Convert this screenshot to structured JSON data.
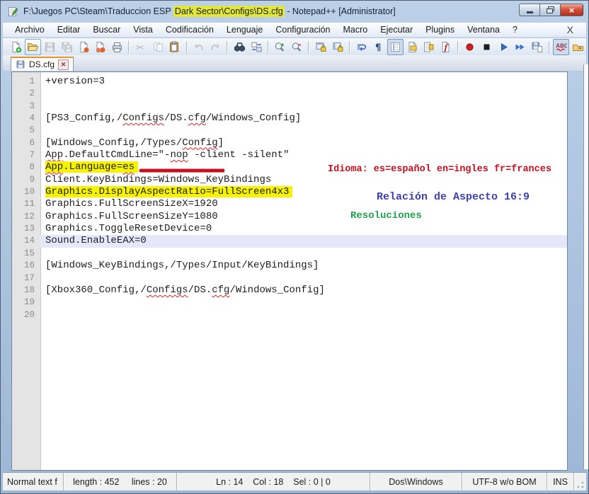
{
  "window": {
    "title_prefix": "F:\\Juegos PC\\Steam\\Traduccion ESP ",
    "title_highlight": "Dark Sector\\Configs\\DS.cfg",
    "title_suffix": " - Notepad++ [Administrator]"
  },
  "menu": {
    "items": [
      "Archivo",
      "Editar",
      "Buscar",
      "Vista",
      "Codificación",
      "Lenguaje",
      "Configuración",
      "Macro",
      "Ejecutar",
      "Plugins",
      "Ventana",
      "?"
    ],
    "close_label": "X"
  },
  "toolbar": {
    "items": [
      {
        "name": "new-file",
        "state": "normal"
      },
      {
        "name": "open-file",
        "state": "hover"
      },
      {
        "name": "save",
        "state": "disabled"
      },
      {
        "name": "save-all",
        "state": "disabled"
      },
      {
        "name": "close",
        "state": "normal"
      },
      {
        "name": "close-all",
        "state": "normal"
      },
      {
        "name": "print",
        "state": "normal"
      },
      {
        "sep": true
      },
      {
        "name": "cut",
        "state": "disabled"
      },
      {
        "name": "copy",
        "state": "disabled"
      },
      {
        "name": "paste",
        "state": "normal"
      },
      {
        "sep": true
      },
      {
        "name": "undo",
        "state": "disabled"
      },
      {
        "name": "redo",
        "state": "disabled"
      },
      {
        "sep": true
      },
      {
        "name": "find",
        "state": "normal"
      },
      {
        "name": "replace",
        "state": "normal"
      },
      {
        "sep": true
      },
      {
        "name": "zoom-in",
        "state": "normal"
      },
      {
        "name": "zoom-out",
        "state": "normal"
      },
      {
        "sep": true
      },
      {
        "name": "sync-vertical",
        "state": "normal"
      },
      {
        "name": "sync-horizontal",
        "state": "normal"
      },
      {
        "sep": true
      },
      {
        "name": "word-wrap",
        "state": "normal"
      },
      {
        "name": "show-all-characters",
        "state": "normal"
      },
      {
        "name": "indent-guide",
        "state": "pressed"
      },
      {
        "name": "user-defined-dialog",
        "state": "normal"
      },
      {
        "name": "doc-map",
        "state": "normal"
      },
      {
        "name": "function-list",
        "state": "normal"
      },
      {
        "sep": true
      },
      {
        "name": "macro-record",
        "state": "normal"
      },
      {
        "name": "macro-stop",
        "state": "normal"
      },
      {
        "name": "macro-play",
        "state": "normal"
      },
      {
        "name": "macro-run-multiple",
        "state": "normal"
      },
      {
        "name": "macro-save",
        "state": "normal"
      },
      {
        "sep": true
      },
      {
        "name": "spell-check",
        "state": "pressed"
      },
      {
        "name": "open-in-explorer",
        "state": "normal"
      }
    ]
  },
  "tab": {
    "label": "DS.cfg"
  },
  "editor": {
    "highlight_color": "#f6f200",
    "current_line_color": "#e7e7fb",
    "lines": [
      {
        "n": 1,
        "segments": [
          {
            "t": "+version=3"
          }
        ]
      },
      {
        "n": 2,
        "segments": []
      },
      {
        "n": 3,
        "segments": []
      },
      {
        "n": 4,
        "segments": [
          {
            "t": "[PS3_Config,/"
          },
          {
            "t": "Configs",
            "sq": true
          },
          {
            "t": "/DS."
          },
          {
            "t": "cfg",
            "sq": true
          },
          {
            "t": "/Windows_Config]"
          }
        ]
      },
      {
        "n": 5,
        "segments": []
      },
      {
        "n": 6,
        "segments": [
          {
            "t": "[Windows_Config,/Types/"
          },
          {
            "t": "Config",
            "sq": true
          },
          {
            "t": "]"
          }
        ]
      },
      {
        "n": 7,
        "segments": [
          {
            "t": "App",
            "sq": true
          },
          {
            "t": ".DefaultCmdLine=\"-"
          },
          {
            "t": "nop",
            "sq": true
          },
          {
            "t": " -client -silent\""
          }
        ]
      },
      {
        "n": 8,
        "hl": true,
        "segments": [
          {
            "t": "App",
            "sq": true
          },
          {
            "t": ".Language="
          },
          {
            "t": "es",
            "sq": true
          }
        ]
      },
      {
        "n": 9,
        "segments": [
          {
            "t": "Client.KeyBindings=Windows_KeyBindings"
          }
        ]
      },
      {
        "n": 10,
        "hl": true,
        "segments": [
          {
            "t": "Graphics.DisplayAspectRatio=FullScreen4x3"
          }
        ]
      },
      {
        "n": 11,
        "segments": [
          {
            "t": "Graphics.FullScreenSizeX=1920"
          }
        ]
      },
      {
        "n": 12,
        "segments": [
          {
            "t": "Graphics.FullScreenSizeY=1080"
          }
        ]
      },
      {
        "n": 13,
        "segments": [
          {
            "t": "Graphics.ToggleResetDevice=0"
          }
        ]
      },
      {
        "n": 14,
        "current": true,
        "segments": [
          {
            "t": "Sound.EnableEAX=0"
          }
        ]
      },
      {
        "n": 15,
        "segments": []
      },
      {
        "n": 16,
        "segments": [
          {
            "t": "[Windows_KeyBindings,/Types/Input/KeyBindings]"
          }
        ]
      },
      {
        "n": 17,
        "segments": []
      },
      {
        "n": 18,
        "segments": [
          {
            "t": "[Xbox360_Config,/"
          },
          {
            "t": "Configs",
            "sq": true
          },
          {
            "t": "/DS."
          },
          {
            "t": "cfg",
            "sq": true
          },
          {
            "t": "/Windows_Config]"
          }
        ]
      },
      {
        "n": 19,
        "segments": []
      },
      {
        "n": 20,
        "segments": []
      }
    ]
  },
  "annotations": {
    "language": {
      "text": "Idioma: es=español en=ingles fr=frances",
      "color": "#c5101f"
    },
    "aspect": {
      "text": "Relación de Aspecto 16:9",
      "color": "#3c3fae"
    },
    "resolution": {
      "text": "Resoluciones",
      "color": "#1fa24c"
    }
  },
  "statusbar": {
    "doc_type": "Normal text f",
    "doc_stats": "length : 452     lines : 20",
    "caret": "Ln : 14    Col : 18    Sel : 0 | 0",
    "eol": "Dos\\Windows",
    "encoding": "UTF-8 w/o BOM",
    "insert_mode": "INS"
  }
}
